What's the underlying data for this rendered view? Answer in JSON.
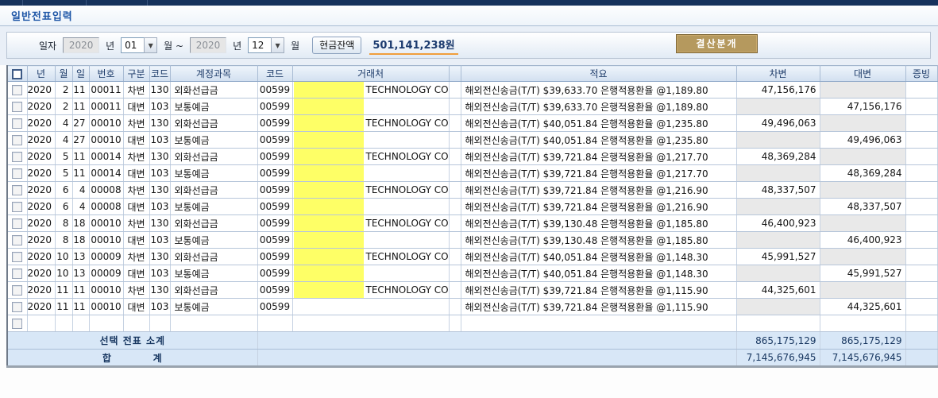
{
  "title": "일반전표입력",
  "filter": {
    "date_label": "일자",
    "year_from": "2020",
    "year_suffix1": "년",
    "month_from": "01",
    "month_suffix1": "월 ~",
    "year_to": "2020",
    "year_suffix2": "년",
    "month_to": "12",
    "month_suffix2": "월",
    "cash_button": "현금잔액",
    "cash_amount": "501,141,238원",
    "closing_button": "결산분개"
  },
  "table": {
    "headers": [
      "년",
      "월",
      "일",
      "번호",
      "구분",
      "코드",
      "계정과목",
      "코드",
      "거래처",
      "",
      "적요",
      "차변",
      "대변",
      "증빙"
    ],
    "rows": [
      {
        "year": "2020",
        "month": "2",
        "day": "11",
        "no": "00011",
        "type": "차변",
        "code": "130",
        "account": "외화선급금",
        "code2": "00599",
        "vendor": "TECHNOLOGY CO",
        "highlight": true,
        "desc": "해외전신송금(T/T) $39,633.70 은행적용환율 @1,189.80",
        "debit": "47,156,176",
        "credit": ""
      },
      {
        "year": "2020",
        "month": "2",
        "day": "11",
        "no": "00011",
        "type": "대변",
        "code": "103",
        "account": "보통예금",
        "code2": "00599",
        "vendor": "",
        "highlight": true,
        "desc": "해외전신송금(T/T) $39,633.70 은행적용환율 @1,189.80",
        "debit": "",
        "credit": "47,156,176"
      },
      {
        "year": "2020",
        "month": "4",
        "day": "27",
        "no": "00010",
        "type": "차변",
        "code": "130",
        "account": "외화선급금",
        "code2": "00599",
        "vendor": "TECHNOLOGY CO",
        "highlight": true,
        "desc": "해외전신송금(T/T) $40,051.84 은행적용환율 @1,235.80",
        "debit": "49,496,063",
        "credit": ""
      },
      {
        "year": "2020",
        "month": "4",
        "day": "27",
        "no": "00010",
        "type": "대변",
        "code": "103",
        "account": "보통예금",
        "code2": "00599",
        "vendor": "",
        "highlight": true,
        "desc": "해외전신송금(T/T) $40,051.84 은행적용환율 @1,235.80",
        "debit": "",
        "credit": "49,496,063"
      },
      {
        "year": "2020",
        "month": "5",
        "day": "11",
        "no": "00014",
        "type": "차변",
        "code": "130",
        "account": "외화선급금",
        "code2": "00599",
        "vendor": "TECHNOLOGY CO",
        "highlight": true,
        "desc": "해외전신송금(T/T) $39,721.84 은행적용환율 @1,217.70",
        "debit": "48,369,284",
        "credit": ""
      },
      {
        "year": "2020",
        "month": "5",
        "day": "11",
        "no": "00014",
        "type": "대변",
        "code": "103",
        "account": "보통예금",
        "code2": "00599",
        "vendor": "",
        "highlight": true,
        "desc": "해외전신송금(T/T) $39,721.84 은행적용환율 @1,217.70",
        "debit": "",
        "credit": "48,369,284"
      },
      {
        "year": "2020",
        "month": "6",
        "day": "4",
        "no": "00008",
        "type": "차변",
        "code": "130",
        "account": "외화선급금",
        "code2": "00599",
        "vendor": "TECHNOLOGY CO",
        "highlight": true,
        "desc": "해외전신송금(T/T) $39,721.84 은행적용환율 @1,216.90",
        "debit": "48,337,507",
        "credit": ""
      },
      {
        "year": "2020",
        "month": "6",
        "day": "4",
        "no": "00008",
        "type": "대변",
        "code": "103",
        "account": "보통예금",
        "code2": "00599",
        "vendor": "",
        "highlight": true,
        "desc": "해외전신송금(T/T) $39,721.84 은행적용환율 @1,216.90",
        "debit": "",
        "credit": "48,337,507"
      },
      {
        "year": "2020",
        "month": "8",
        "day": "18",
        "no": "00010",
        "type": "차변",
        "code": "130",
        "account": "외화선급금",
        "code2": "00599",
        "vendor": "TECHNOLOGY CO",
        "highlight": true,
        "desc": "해외전신송금(T/T) $39,130.48 은행적용환율 @1,185.80",
        "debit": "46,400,923",
        "credit": ""
      },
      {
        "year": "2020",
        "month": "8",
        "day": "18",
        "no": "00010",
        "type": "대변",
        "code": "103",
        "account": "보통예금",
        "code2": "00599",
        "vendor": "",
        "highlight": true,
        "desc": "해외전신송금(T/T) $39,130.48 은행적용환율 @1,185.80",
        "debit": "",
        "credit": "46,400,923"
      },
      {
        "year": "2020",
        "month": "10",
        "day": "13",
        "no": "00009",
        "type": "차변",
        "code": "130",
        "account": "외화선급금",
        "code2": "00599",
        "vendor": "TECHNOLOGY CO",
        "highlight": true,
        "desc": "해외전신송금(T/T) $40,051.84 은행적용환율 @1,148.30",
        "debit": "45,991,527",
        "credit": ""
      },
      {
        "year": "2020",
        "month": "10",
        "day": "13",
        "no": "00009",
        "type": "대변",
        "code": "103",
        "account": "보통예금",
        "code2": "00599",
        "vendor": "",
        "highlight": true,
        "desc": "해외전신송금(T/T) $40,051.84 은행적용환율 @1,148.30",
        "debit": "",
        "credit": "45,991,527"
      },
      {
        "year": "2020",
        "month": "11",
        "day": "11",
        "no": "00010",
        "type": "차변",
        "code": "130",
        "account": "외화선급금",
        "code2": "00599",
        "vendor": "TECHNOLOGY CO",
        "highlight": true,
        "desc": "해외전신송금(T/T) $39,721.84 은행적용환율 @1,115.90",
        "debit": "44,325,601",
        "credit": ""
      },
      {
        "year": "2020",
        "month": "11",
        "day": "11",
        "no": "00010",
        "type": "대변",
        "code": "103",
        "account": "보통예금",
        "code2": "00599",
        "vendor": "",
        "highlight": false,
        "desc": "해외전신송금(T/T) $39,721.84 은행적용환율 @1,115.90",
        "debit": "",
        "credit": "44,325,601"
      }
    ],
    "subtotal": {
      "label": "선택 전표 소계",
      "debit": "865,175,129",
      "credit": "865,175,129"
    },
    "total": {
      "label": "합          계",
      "debit": "7,145,676,945",
      "credit": "7,145,676,945"
    }
  }
}
